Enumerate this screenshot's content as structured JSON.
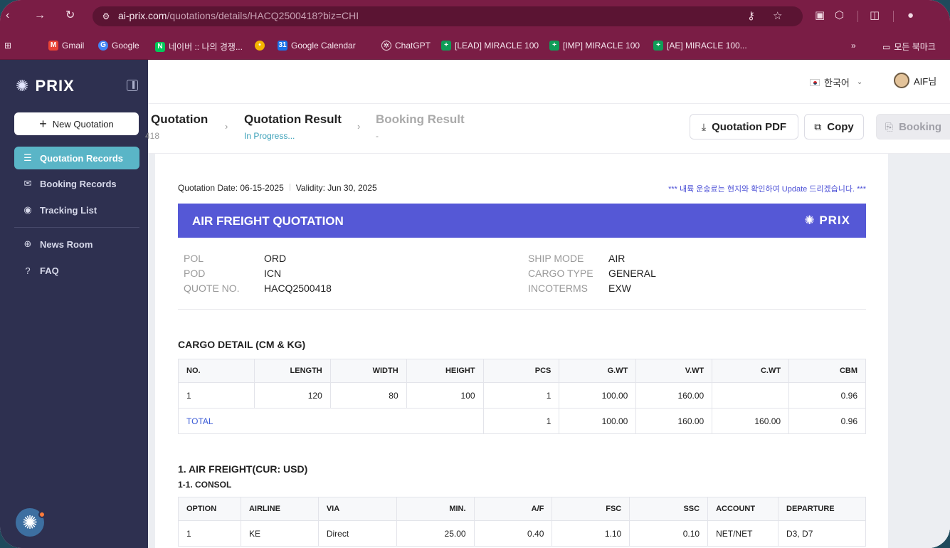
{
  "browser": {
    "url_host": "ai-prix.com",
    "url_path": "/quotations/details/HACQ2500418?biz=CHI",
    "bookmarks": [
      {
        "label": "Gmail",
        "color": "#ea4335",
        "glyph": "M"
      },
      {
        "label": "Google",
        "color": "#4285f4",
        "glyph": "G"
      },
      {
        "label": "네이버 :: 나의 경쟁...",
        "color": "#03c75a",
        "glyph": "N"
      },
      {
        "label": "",
        "color": "#f4b400",
        "glyph": "⚲"
      },
      {
        "label": "Google Calendar",
        "color": "#1a73e8",
        "glyph": "31"
      },
      {
        "label": "ChatGPT",
        "color": "#10a37f",
        "glyph": "◎"
      },
      {
        "label": "[LEAD] MIRACLE 100",
        "color": "#0f9d58",
        "glyph": "+"
      },
      {
        "label": "[IMP] MIRACLE 100",
        "color": "#0f9d58",
        "glyph": "+"
      },
      {
        "label": "[AE] MIRACLE 100...",
        "color": "#0f9d58",
        "glyph": "+"
      }
    ],
    "bookmarks_more": "»",
    "all_bookmarks": "모든 북마크"
  },
  "sidebar": {
    "logo_text": "PRIX",
    "new_quotation": "New Quotation",
    "items": [
      {
        "label": "Quotation Records",
        "icon": "list-icon",
        "glyph": "☰",
        "active": true
      },
      {
        "label": "Booking Records",
        "icon": "mail-icon",
        "glyph": "✉",
        "active": false
      },
      {
        "label": "Tracking List",
        "icon": "location-pin-icon",
        "glyph": "◉",
        "active": false
      },
      {
        "label": "News Room",
        "icon": "globe-icon",
        "glyph": "⊕",
        "active": false
      },
      {
        "label": "FAQ",
        "icon": "help-icon",
        "glyph": "?",
        "active": false
      }
    ]
  },
  "topbar": {
    "language": "한국어",
    "user": "AIF님"
  },
  "steps": [
    {
      "title": "Quotation",
      "sub": "418"
    },
    {
      "title": "Quotation Result",
      "sub": "In Progress..."
    },
    {
      "title": "Booking Result",
      "sub": "-"
    }
  ],
  "actions": {
    "pdf": "Quotation PDF",
    "copy": "Copy",
    "booking": "Booking"
  },
  "quote": {
    "date_text": "Quotation Date: 06-15-2025",
    "validity_text": "Validity: Jun 30, 2025",
    "notice": "*** 내륙 운송료는 현지와 확인하여 Update 드리겠습니다. ***",
    "banner_title": "AIR FREIGHT QUOTATION",
    "banner_logo": "PRIX",
    "left_info": [
      {
        "k": "POL",
        "v": "ORD"
      },
      {
        "k": "POD",
        "v": "ICN"
      },
      {
        "k": "QUOTE NO.",
        "v": "HACQ2500418"
      }
    ],
    "right_info": [
      {
        "k": "SHIP MODE",
        "v": "AIR"
      },
      {
        "k": "CARGO TYPE",
        "v": "GENERAL"
      },
      {
        "k": "INCOTERMS",
        "v": "EXW"
      }
    ]
  },
  "cargo": {
    "title": "CARGO DETAIL (CM & KG)",
    "headers": [
      "NO.",
      "LENGTH",
      "WIDTH",
      "HEIGHT",
      "PCS",
      "G.WT",
      "V.WT",
      "C.WT",
      "CBM"
    ],
    "rows": [
      [
        "1",
        "120",
        "80",
        "100",
        "1",
        "100.00",
        "160.00",
        "",
        "0.96"
      ]
    ],
    "total": [
      "TOTAL",
      "1",
      "100.00",
      "160.00",
      "160.00",
      "0.96"
    ]
  },
  "freight": {
    "title": "1. AIR FREIGHT(CUR: USD)",
    "subtitle": "1-1. CONSOL",
    "headers": [
      "OPTION",
      "AIRLINE",
      "VIA",
      "MIN.",
      "A/F",
      "FSC",
      "SSC",
      "ACCOUNT",
      "DEPARTURE"
    ],
    "rows": [
      [
        "1",
        "KE",
        "Direct",
        "25.00",
        "0.40",
        "1.10",
        "0.10",
        "NET/NET",
        "D3, D7"
      ]
    ]
  }
}
